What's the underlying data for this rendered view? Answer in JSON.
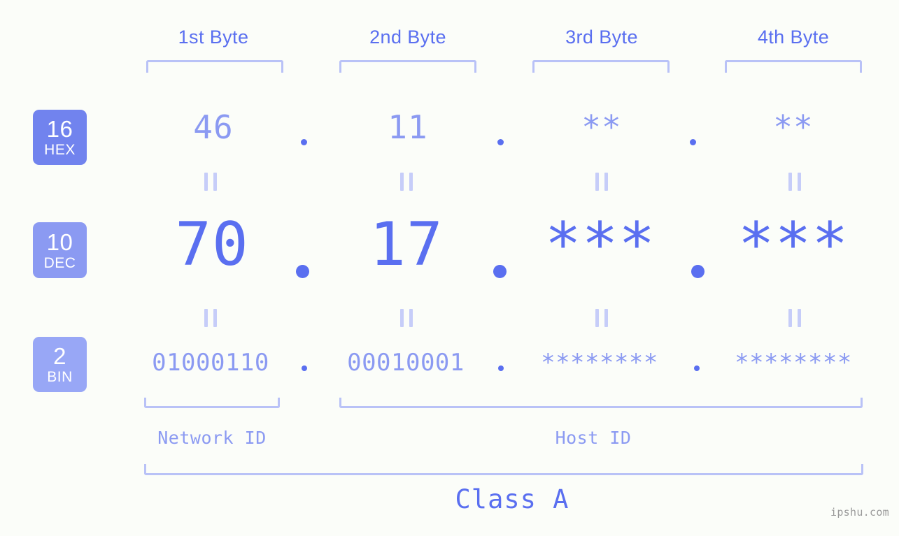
{
  "meta": {
    "watermark": "ipshu.com",
    "accent_dark": "#5a6ff0",
    "accent_mid": "#8b9af2",
    "accent_light": "#b9c2f7",
    "background": "#fbfdf9"
  },
  "byte_headers": [
    {
      "label": "1st Byte"
    },
    {
      "label": "2nd Byte"
    },
    {
      "label": "3rd Byte"
    },
    {
      "label": "4th Byte"
    }
  ],
  "rows": [
    {
      "id": "hex",
      "badge_number": "16",
      "badge_abbr": "HEX",
      "badge_color": "#7183ee",
      "values": [
        "46",
        "11",
        "**",
        "**"
      ],
      "separator": "."
    },
    {
      "id": "dec",
      "badge_number": "10",
      "badge_abbr": "DEC",
      "badge_color": "#8b9af2",
      "values": [
        "70",
        "17",
        "***",
        "***"
      ],
      "separator": "."
    },
    {
      "id": "bin",
      "badge_number": "2",
      "badge_abbr": "BIN",
      "badge_color": "#98a7f6",
      "values": [
        "01000110",
        "00010001",
        "********",
        "********"
      ],
      "separator": "."
    }
  ],
  "equals_marker": "=",
  "sections": [
    {
      "label": "Network ID"
    },
    {
      "label": "Host ID"
    }
  ],
  "class": {
    "label": "Class A"
  }
}
